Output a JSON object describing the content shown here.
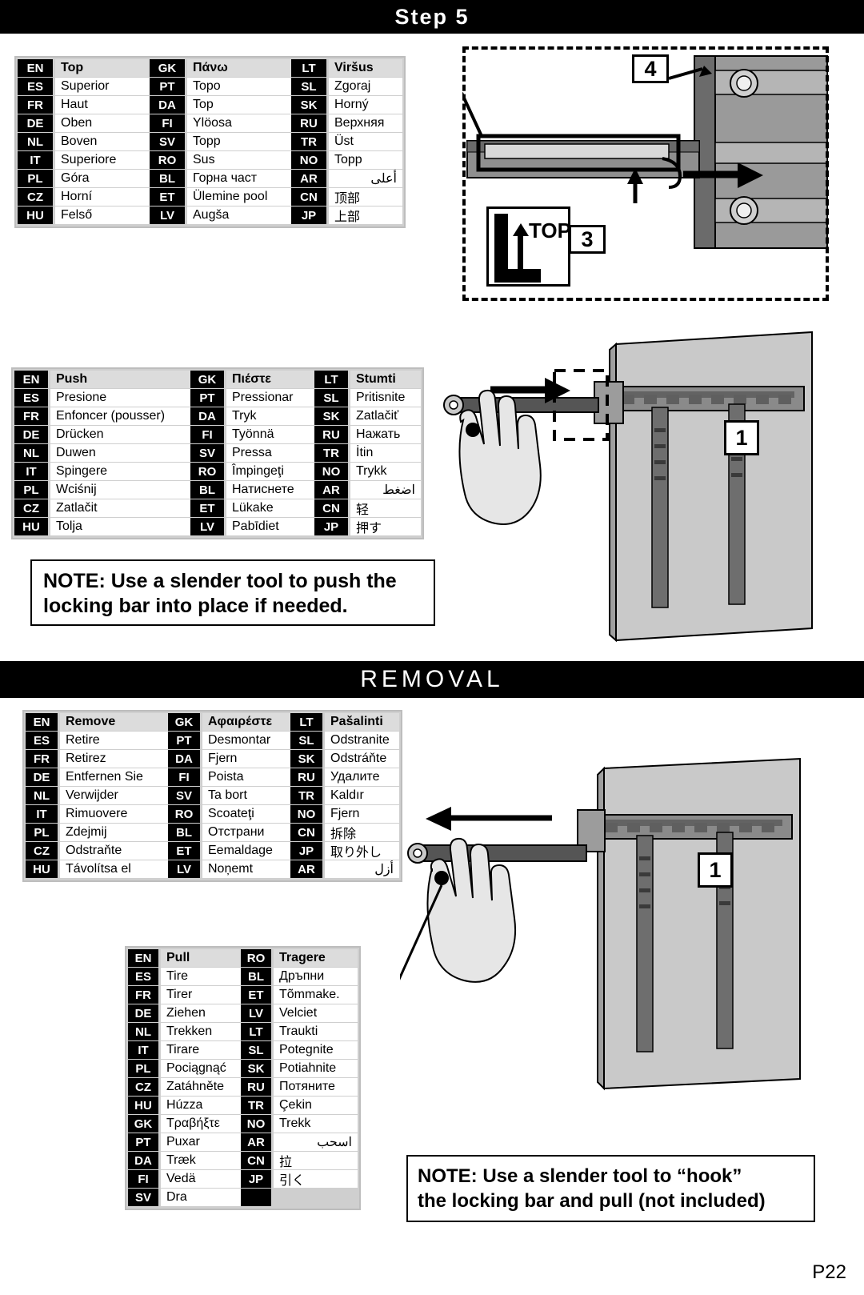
{
  "header": {
    "step_title": "Step 5",
    "removal_title": "REMOVAL"
  },
  "page_number": "P22",
  "tables": {
    "top": {
      "highlight_row": 0,
      "rows": [
        {
          "c1": "EN",
          "t1": "Top",
          "c2": "GK",
          "t2": "Πάνω",
          "c3": "LT",
          "t3": "Viršus"
        },
        {
          "c1": "ES",
          "t1": "Superior",
          "c2": "PT",
          "t2": "Topo",
          "c3": "SL",
          "t3": "Zgoraj"
        },
        {
          "c1": "FR",
          "t1": "Haut",
          "c2": "DA",
          "t2": "Top",
          "c3": "SK",
          "t3": "Horný"
        },
        {
          "c1": "DE",
          "t1": "Oben",
          "c2": "FI",
          "t2": "Ylöosa",
          "c3": "RU",
          "t3": "Верхняя"
        },
        {
          "c1": "NL",
          "t1": "Boven",
          "c2": "SV",
          "t2": "Topp",
          "c3": "TR",
          "t3": "Üst"
        },
        {
          "c1": "IT",
          "t1": "Superiore",
          "c2": "RO",
          "t2": "Sus",
          "c3": "NO",
          "t3": "Topp"
        },
        {
          "c1": "PL",
          "t1": "Góra",
          "c2": "BL",
          "t2": "Горна част",
          "c3": "AR",
          "t3": "أعلى"
        },
        {
          "c1": "CZ",
          "t1": "Horní",
          "c2": "ET",
          "t2": "Ülemine pool",
          "c3": "CN",
          "t3": "顶部"
        },
        {
          "c1": "HU",
          "t1": "Felső",
          "c2": "LV",
          "t2": "Augša",
          "c3": "JP",
          "t3": "上部"
        }
      ]
    },
    "push": {
      "highlight_row": 0,
      "rows": [
        {
          "c1": "EN",
          "t1": "Push",
          "c2": "GK",
          "t2": "Πιέστε",
          "c3": "LT",
          "t3": "Stumti"
        },
        {
          "c1": "ES",
          "t1": "Presione",
          "c2": "PT",
          "t2": "Pressionar",
          "c3": "SL",
          "t3": "Pritisnite"
        },
        {
          "c1": "FR",
          "t1": "Enfoncer (pousser)",
          "c2": "DA",
          "t2": "Tryk",
          "c3": "SK",
          "t3": "Zatlačiť"
        },
        {
          "c1": "DE",
          "t1": "Drücken",
          "c2": "FI",
          "t2": "Työnnä",
          "c3": "RU",
          "t3": "Нажать"
        },
        {
          "c1": "NL",
          "t1": "Duwen",
          "c2": "SV",
          "t2": "Pressa",
          "c3": "TR",
          "t3": "İtin"
        },
        {
          "c1": "IT",
          "t1": "Spingere",
          "c2": "RO",
          "t2": "Împingeţi",
          "c3": "NO",
          "t3": "Trykk"
        },
        {
          "c1": "PL",
          "t1": "Wciśnij",
          "c2": "BL",
          "t2": "Натиснете",
          "c3": "AR",
          "t3": "اضغط"
        },
        {
          "c1": "CZ",
          "t1": "Zatlačit",
          "c2": "ET",
          "t2": "Lükake",
          "c3": "CN",
          "t3": "轻"
        },
        {
          "c1": "HU",
          "t1": "Tolja",
          "c2": "LV",
          "t2": "Pabīdiet",
          "c3": "JP",
          "t3": "押す"
        }
      ]
    },
    "remove": {
      "highlight_row": 0,
      "rows": [
        {
          "c1": "EN",
          "t1": "Remove",
          "c2": "GK",
          "t2": "Αφαιρέστε",
          "c3": "LT",
          "t3": "Pašalinti"
        },
        {
          "c1": "ES",
          "t1": "Retire",
          "c2": "PT",
          "t2": "Desmontar",
          "c3": "SL",
          "t3": "Odstranite"
        },
        {
          "c1": "FR",
          "t1": "Retirez",
          "c2": "DA",
          "t2": "Fjern",
          "c3": "SK",
          "t3": "Odstráňte"
        },
        {
          "c1": "DE",
          "t1": "Entfernen Sie",
          "c2": "FI",
          "t2": "Poista",
          "c3": "RU",
          "t3": "Удалите"
        },
        {
          "c1": "NL",
          "t1": "Verwijder",
          "c2": "SV",
          "t2": "Ta bort",
          "c3": "TR",
          "t3": "Kaldır"
        },
        {
          "c1": "IT",
          "t1": "Rimuovere",
          "c2": "RO",
          "t2": "Scoateţi",
          "c3": "NO",
          "t3": "Fjern"
        },
        {
          "c1": "PL",
          "t1": "Zdejmij",
          "c2": "BL",
          "t2": "Отстрани",
          "c3": "CN",
          "t3": "拆除"
        },
        {
          "c1": "CZ",
          "t1": "Odstraňte",
          "c2": "ET",
          "t2": "Eemaldage",
          "c3": "JP",
          "t3": "取り外し"
        },
        {
          "c1": "HU",
          "t1": "Távolítsa el",
          "c2": "LV",
          "t2": "Noņemt",
          "c3": "AR",
          "t3": "أزل"
        }
      ]
    },
    "pull": {
      "highlight_row": 0,
      "rows": [
        {
          "c1": "EN",
          "t1": "Pull",
          "c2": "RO",
          "t2": "Tragere"
        },
        {
          "c1": "ES",
          "t1": "Tire",
          "c2": "BL",
          "t2": "Дръпни"
        },
        {
          "c1": "FR",
          "t1": "Tirer",
          "c2": "ET",
          "t2": "Tõmmake."
        },
        {
          "c1": "DE",
          "t1": "Ziehen",
          "c2": "LV",
          "t2": "Velciet"
        },
        {
          "c1": "NL",
          "t1": "Trekken",
          "c2": "LT",
          "t2": "Traukti"
        },
        {
          "c1": "IT",
          "t1": "Tirare",
          "c2": "SL",
          "t2": "Potegnite"
        },
        {
          "c1": "PL",
          "t1": "Pociągnąć",
          "c2": "SK",
          "t2": "Potiahnite"
        },
        {
          "c1": "CZ",
          "t1": "Zatáhněte",
          "c2": "RU",
          "t2": "Потяните"
        },
        {
          "c1": "HU",
          "t1": "Húzza",
          "c2": "TR",
          "t2": "Çekin"
        },
        {
          "c1": "GK",
          "t1": "Τραβήξτε",
          "c2": "NO",
          "t2": "Trekk"
        },
        {
          "c1": "PT",
          "t1": "Puxar",
          "c2": "AR",
          "t2": "اسحب"
        },
        {
          "c1": "DA",
          "t1": "Træk",
          "c2": "CN",
          "t2": "拉"
        },
        {
          "c1": "FI",
          "t1": "Vedä",
          "c2": "JP",
          "t2": "引く"
        },
        {
          "c1": "SV",
          "t1": "Dra",
          "c2": "",
          "t2": ""
        }
      ]
    }
  },
  "notes": {
    "push_note_line1": "NOTE: Use a slender tool to push the",
    "push_note_line2": "locking bar into place if needed.",
    "pull_note_line1": "NOTE:  Use a slender tool to “hook”",
    "pull_note_line2": "the locking bar and pull (not included)"
  },
  "callouts": {
    "step_top_4": "4",
    "step_top_3": "3",
    "push_1": "1",
    "removal_1": "1",
    "top_label": "TOP"
  }
}
